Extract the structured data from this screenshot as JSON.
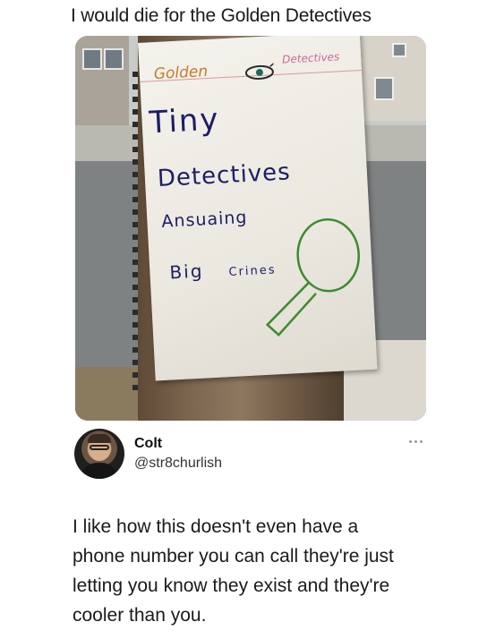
{
  "headline": "I would die for the Golden Detectives",
  "photo": {
    "sign": {
      "golden": "Golden",
      "detectives_small": "Detectives",
      "tiny": "Tiny",
      "detectives": "Detectives",
      "answering": "Ansuaing",
      "big": "Big",
      "crimes": "Crines"
    }
  },
  "tweet": {
    "display_name": "Colt",
    "handle": "@str8churlish",
    "body_lines": [
      "I like how this doesn't even have a",
      "phone number you can call they're just",
      "letting you know they exist and they're",
      "cooler than you."
    ]
  },
  "icons": {
    "more": "more-options-icon",
    "eye": "eye-icon",
    "magnifier": "magnifying-glass-icon"
  }
}
